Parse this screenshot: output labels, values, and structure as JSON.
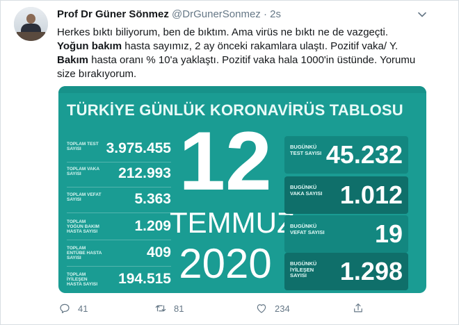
{
  "tweet": {
    "author_name": "Prof Dr Güner Sönmez",
    "handle": "@DrGunerSonmez",
    "separator": "·",
    "time": "2s",
    "text_parts": [
      {
        "bold": false,
        "text": "Herkes bıktı biliyorum, ben de bıktım. Ama virüs ne bıktı ne de vazgeçti. "
      },
      {
        "bold": true,
        "text": "Yoğun bakım"
      },
      {
        "bold": false,
        "text": " hasta sayımız, 2 ay önceki rakamlara ulaştı. Pozitif vaka/ Y. "
      },
      {
        "bold": true,
        "text": "Bakım"
      },
      {
        "bold": false,
        "text": " hasta oranı % 10'a yaklaştı. Pozitif vaka hala 1000'in üstünde. Yorumu size bırakıyorum."
      }
    ]
  },
  "card": {
    "title": "TÜRKİYE GÜNLÜK KORONAVİRÜS TABLOSU",
    "left_stats": [
      {
        "label": "TOPLAM TEST SAYISI",
        "value": "3.975.455"
      },
      {
        "label": "TOPLAM VAKA SAYISI",
        "value": "212.993"
      },
      {
        "label": "TOPLAM VEFAT SAYISI",
        "value": "5.363"
      },
      {
        "label": "TOPLAM YOĞUN BAKIM HASTA SAYISI",
        "value": "1.209"
      },
      {
        "label": "TOPLAM ENTÜBE HASTA SAYISI",
        "value": "409"
      },
      {
        "label": "TOPLAM İYİLEŞEN HASTA SAYISI",
        "value": "194.515"
      }
    ],
    "day": "12",
    "month": "TEMMUZ",
    "year": "2020",
    "right_stats": [
      {
        "label": "BUGÜNKÜ TEST SAYISI",
        "value": "45.232"
      },
      {
        "label": "BUGÜNKÜ VAKA SAYISI",
        "value": "1.012"
      },
      {
        "label": "BUGÜNKÜ VEFAT SAYISI",
        "value": "19"
      },
      {
        "label": "BUGÜNKÜ İYİLEŞEN SAYISI",
        "value": "1.298"
      }
    ]
  },
  "actions": {
    "reply_count": "41",
    "retweet_count": "81",
    "like_count": "234"
  },
  "icons": {
    "reply": "reply-icon",
    "retweet": "retweet-icon",
    "like": "heart-icon",
    "share": "share-icon",
    "caret": "chevron-down-icon"
  },
  "colors": {
    "card_bg": "#1a9c93",
    "box_bg": "#138780",
    "box_alt_bg": "#0f6f6a",
    "muted": "#657786"
  }
}
